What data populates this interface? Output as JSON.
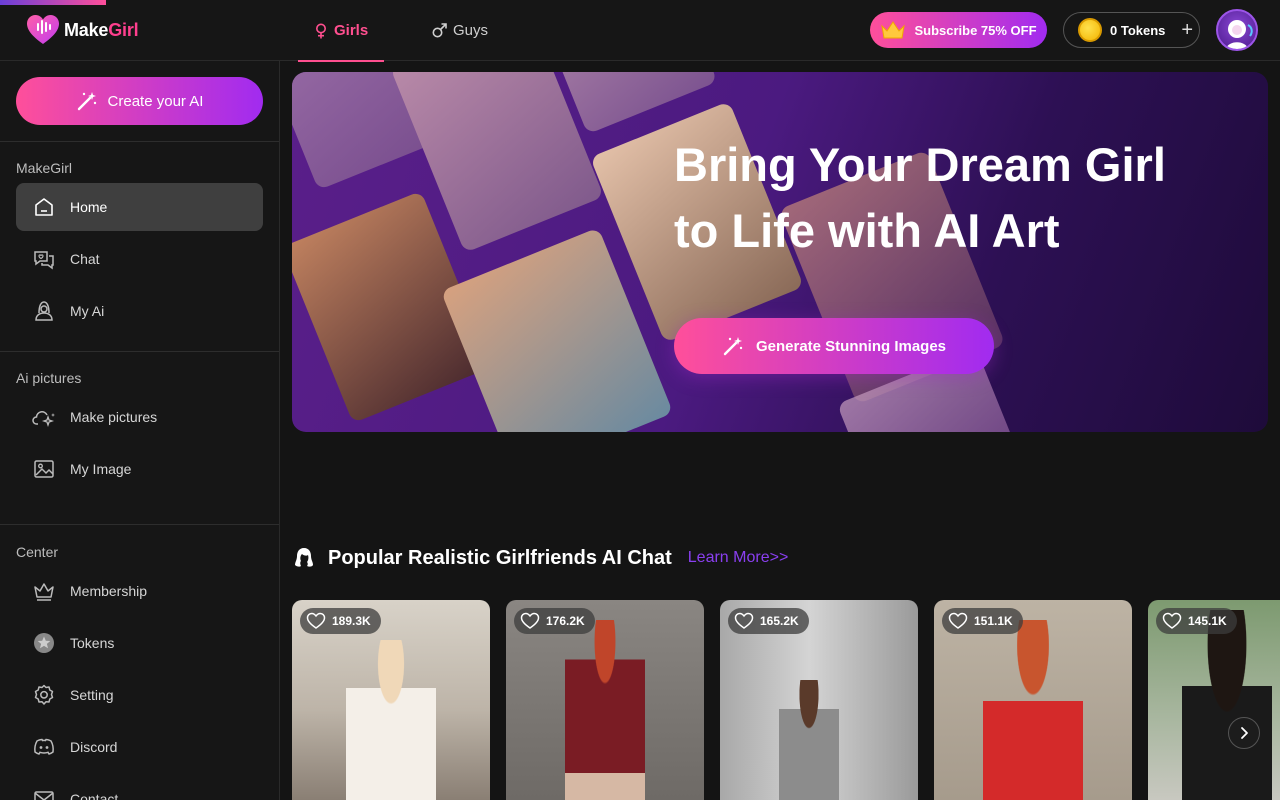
{
  "brand": {
    "name_part1": "Make",
    "name_part2": "Girl"
  },
  "nav": {
    "tabs": [
      {
        "label": "Girls",
        "icon": "female-symbol-icon",
        "active": true
      },
      {
        "label": "Guys",
        "icon": "male-symbol-icon",
        "active": false
      }
    ]
  },
  "header": {
    "subscribe_label": "Subscribe 75% OFF",
    "tokens_label": "0 Tokens",
    "tokens_add": "+"
  },
  "sidebar": {
    "create_label": "Create your AI",
    "sections": [
      {
        "title": "MakeGirl",
        "items": [
          {
            "label": "Home",
            "icon": "home-icon",
            "active": true
          },
          {
            "label": "Chat",
            "icon": "chat-icon"
          },
          {
            "label": "My Ai",
            "icon": "my-ai-icon"
          }
        ]
      },
      {
        "title": "Ai pictures",
        "items": [
          {
            "label": "Make pictures",
            "icon": "magic-cloud-icon"
          },
          {
            "label": "My Image",
            "icon": "image-icon"
          }
        ]
      },
      {
        "title": "Center",
        "items": [
          {
            "label": "Membership",
            "icon": "crown-icon"
          },
          {
            "label": "Tokens",
            "icon": "star-coin-icon"
          },
          {
            "label": "Setting",
            "icon": "gear-icon"
          },
          {
            "label": "Discord",
            "icon": "discord-icon"
          },
          {
            "label": "Contact",
            "icon": "mail-icon"
          }
        ]
      }
    ]
  },
  "hero": {
    "title_line1": "Bring Your Dream Girl",
    "title_line2": "to Life with AI Art",
    "button_label": "Generate Stunning Images"
  },
  "popular": {
    "title": "Popular Realistic Girlfriends AI Chat",
    "learn_more": "Learn More>>",
    "cards": [
      {
        "likes": "189.3K"
      },
      {
        "likes": "176.2K"
      },
      {
        "likes": "165.2K"
      },
      {
        "likes": "151.1K"
      },
      {
        "likes": "145.1K"
      }
    ]
  },
  "colors": {
    "accent_pink": "#ff4f9a",
    "accent_purple": "#a12bf0",
    "link_purple": "#8a3ff0",
    "background": "#141414"
  }
}
